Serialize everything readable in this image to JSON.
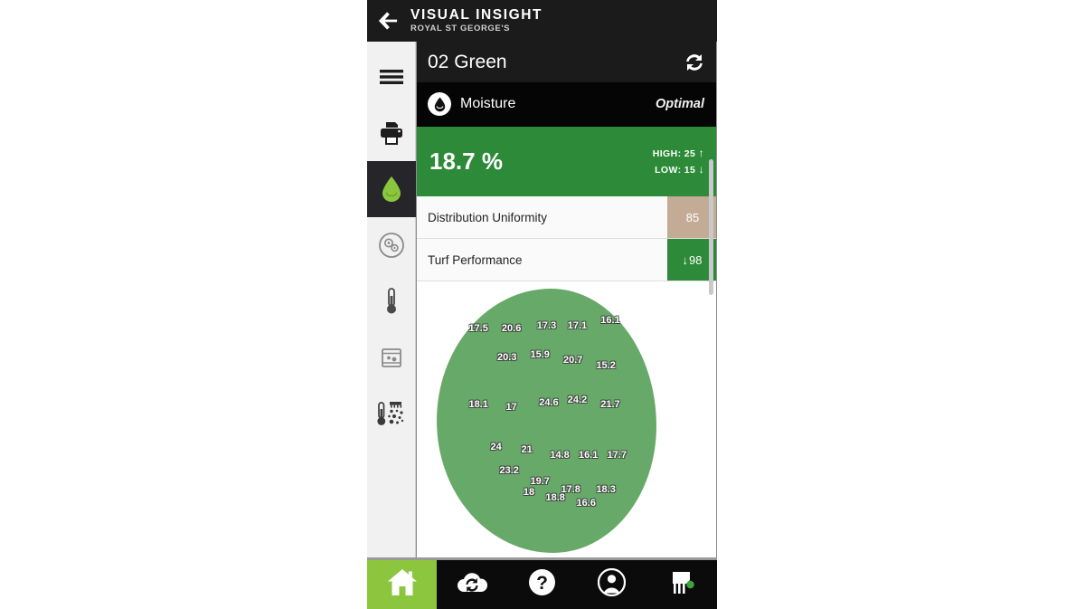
{
  "titlebar": {
    "back_icon": "back-arrow-icon",
    "title": "VISUAL INSIGHT",
    "subtitle": "ROYAL ST GEORGE'S"
  },
  "sidebar": {
    "items": [
      {
        "name": "menu",
        "icon": "hamburger-menu-icon",
        "active": false
      },
      {
        "name": "print",
        "icon": "printer-icon",
        "active": false
      },
      {
        "name": "moisture",
        "icon": "water-drop-icon",
        "active": true
      },
      {
        "name": "soil",
        "icon": "soil-circle-icon",
        "active": false
      },
      {
        "name": "temperature",
        "icon": "thermometer-icon",
        "active": false
      },
      {
        "name": "sample",
        "icon": "beaker-cup-icon",
        "active": false
      },
      {
        "name": "salinity",
        "icon": "salinity-icon",
        "active": false
      }
    ]
  },
  "green_header": {
    "name": "02 Green",
    "refresh_icon": "refresh-icon"
  },
  "metric": {
    "icon": "water-drop-icon",
    "label": "Moisture",
    "status": "Optimal",
    "value": "18.7 %",
    "high_label": "HIGH: 25",
    "high_arrow": "↑",
    "low_label": "LOW: 15",
    "low_arrow": "↓"
  },
  "kpis": [
    {
      "label": "Distribution Uniformity",
      "value": "85",
      "arrow": "",
      "badge_color": "#c4ab95"
    },
    {
      "label": "Turf Performance",
      "value": "98",
      "arrow": "↓",
      "badge_color": "#2c8a38"
    }
  ],
  "colors": {
    "brand_green": "#8cc63e",
    "status_green": "#2c8a38",
    "map_green": "#67a968",
    "tan": "#c4ab95",
    "dark": "#1b1b1b"
  },
  "chart_data": {
    "type": "scatter",
    "title": "02 Green",
    "xlabel": "",
    "ylabel": "",
    "unit": "%",
    "metric": "Moisture",
    "grid": false,
    "legend": "none",
    "xlim": [
      0,
      100
    ],
    "ylim": [
      0,
      100
    ],
    "points": [
      {
        "label": "17.5",
        "value": 17.5,
        "x": 19,
        "y": 15
      },
      {
        "label": "20.6",
        "value": 20.6,
        "x": 34,
        "y": 15
      },
      {
        "label": "17.3",
        "value": 17.3,
        "x": 50,
        "y": 14
      },
      {
        "label": "17.1",
        "value": 17.1,
        "x": 64,
        "y": 14
      },
      {
        "label": "16.1",
        "value": 16.1,
        "x": 79,
        "y": 12
      },
      {
        "label": "20.3",
        "value": 20.3,
        "x": 32,
        "y": 26
      },
      {
        "label": "15.9",
        "value": 15.9,
        "x": 47,
        "y": 25
      },
      {
        "label": "20.7",
        "value": 20.7,
        "x": 62,
        "y": 27
      },
      {
        "label": "15.2",
        "value": 15.2,
        "x": 77,
        "y": 29
      },
      {
        "label": "18.1",
        "value": 18.1,
        "x": 19,
        "y": 44
      },
      {
        "label": "17",
        "value": 17.0,
        "x": 34,
        "y": 45
      },
      {
        "label": "24.6",
        "value": 24.6,
        "x": 51,
        "y": 43
      },
      {
        "label": "24.2",
        "value": 24.2,
        "x": 64,
        "y": 42
      },
      {
        "label": "21.7",
        "value": 21.7,
        "x": 79,
        "y": 44
      },
      {
        "label": "24",
        "value": 24.0,
        "x": 27,
        "y": 60
      },
      {
        "label": "21",
        "value": 21.0,
        "x": 41,
        "y": 61
      },
      {
        "label": "14.8",
        "value": 14.8,
        "x": 56,
        "y": 63
      },
      {
        "label": "16.1",
        "value": 16.1,
        "x": 69,
        "y": 63
      },
      {
        "label": "17.7",
        "value": 17.7,
        "x": 82,
        "y": 63
      },
      {
        "label": "23.2",
        "value": 23.2,
        "x": 33,
        "y": 69
      },
      {
        "label": "19.7",
        "value": 19.7,
        "x": 47,
        "y": 73
      },
      {
        "label": "18",
        "value": 18.0,
        "x": 42,
        "y": 77
      },
      {
        "label": "17.8",
        "value": 17.8,
        "x": 61,
        "y": 76
      },
      {
        "label": "18.8",
        "value": 18.8,
        "x": 54,
        "y": 79
      },
      {
        "label": "18.3",
        "value": 18.3,
        "x": 77,
        "y": 76
      },
      {
        "label": "16.6",
        "value": 16.6,
        "x": 68,
        "y": 81
      }
    ]
  },
  "bottom_nav": {
    "items": [
      {
        "name": "home",
        "icon": "home-icon",
        "active": true
      },
      {
        "name": "sync",
        "icon": "cloud-sync-icon",
        "active": false
      },
      {
        "name": "help",
        "icon": "help-icon",
        "active": false
      },
      {
        "name": "account",
        "icon": "account-icon",
        "active": false
      },
      {
        "name": "turf",
        "icon": "turf-icon",
        "active": false
      }
    ]
  }
}
